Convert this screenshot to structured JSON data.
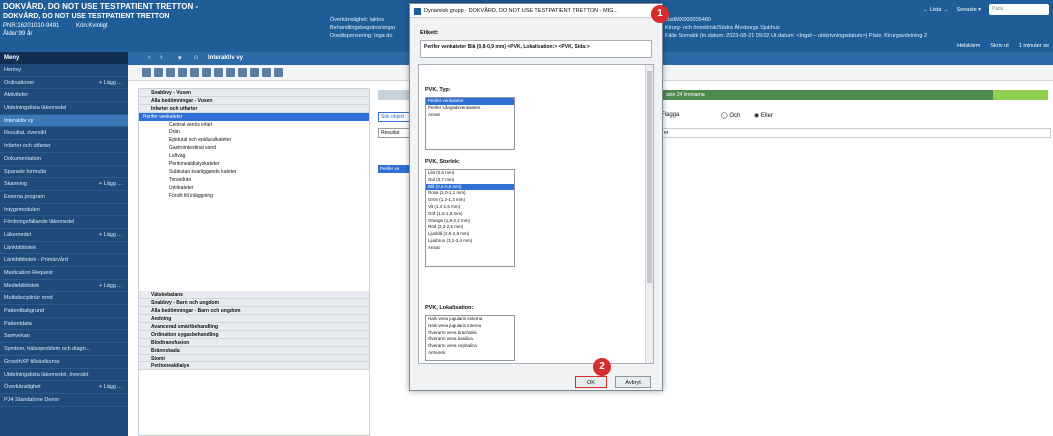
{
  "header": {
    "title": "DOKVÅRD, DO NOT USE TESTPATIENT TRETTON -",
    "subtitle": "DOKVÅRD, DO NOT USE TESTPATIENT TRETTON",
    "pnr": "PNR:16201010-9491",
    "kon": "Kön:Kvinligt",
    "age": "Ålder:99 år",
    "mid_lines": [
      "Överkänslighet: laktos",
      "Behandlingsbegränsningar",
      "Dosdispensering: Inga do"
    ],
    "right_lines": [
      "elsdMX000035480",
      "Kirurg- och öronklinik/Södra Älvsborgs Sjukhus",
      "Fälle Somatik (In.datum: 2023-08-21 09:02 Ut.datum: <Inget – utskrivningsdatum>) Plats: Kirurgavdelning 2"
    ],
    "lista": "← Lista →",
    "senaste": "Senaste ▾",
    "search_placeholder": "Patie",
    "helskarm": "Helskärm",
    "skriv_ut": "Skriv ut",
    "minuter": "1 minuter se"
  },
  "sidebar": {
    "menu_title": "Meny",
    "add_label": "+ Lägg ...",
    "items": [
      {
        "label": "Hemvy",
        "add": false,
        "active": false
      },
      {
        "label": "Ordinationer",
        "add": true,
        "active": false
      },
      {
        "label": "Aktiviteter",
        "add": false,
        "active": false
      },
      {
        "label": "Utdelningslista läkemedel",
        "add": false,
        "active": false
      },
      {
        "label": "Interaktiv vy",
        "add": false,
        "active": true
      },
      {
        "label": "Resultat, översikt",
        "add": false,
        "active": false
      },
      {
        "label": "Infarter och utfarter",
        "add": false,
        "active": false
      },
      {
        "label": "Dokumentation",
        "add": false,
        "active": false
      },
      {
        "label": "Sparade formulär",
        "add": false,
        "active": false
      },
      {
        "label": "Skanning",
        "add": true,
        "active": false
      },
      {
        "label": "Externa program",
        "add": false,
        "active": false
      },
      {
        "label": "Intygsmodulen",
        "add": false,
        "active": false
      },
      {
        "label": "Fördningsfällande läkemedel",
        "add": false,
        "active": false
      },
      {
        "label": "Läkemedel",
        "add": true,
        "active": false
      },
      {
        "label": "Länkbibliotek",
        "add": false,
        "active": false
      },
      {
        "label": "Länkbibliotek - Primärvård",
        "add": false,
        "active": false
      },
      {
        "label": "Medication Request",
        "add": false,
        "active": false
      },
      {
        "label": "Mediebibliotek",
        "add": true,
        "active": false
      },
      {
        "label": "Multidisciplinär rond",
        "add": false,
        "active": false
      },
      {
        "label": "Patientbakgrund",
        "add": false,
        "active": false
      },
      {
        "label": "Patientdata",
        "add": false,
        "active": false
      },
      {
        "label": "Samvekan",
        "add": false,
        "active": false
      },
      {
        "label": "Symtom, hälsoproblem och diagn...",
        "add": false,
        "active": false
      },
      {
        "label": "GrowthXP tillväxtkurva",
        "add": false,
        "active": false
      },
      {
        "label": "Utdelningslista läkemedel, översikt",
        "add": false,
        "active": false
      },
      {
        "label": "Överkänslighet",
        "add": true,
        "active": false
      },
      {
        "label": "PJ4 Standalone Demo",
        "add": false,
        "active": false
      }
    ]
  },
  "main": {
    "tab_label": "Interaktiv vy",
    "tree_top": [
      {
        "label": "Snabbvy - Vuxen",
        "type": "group"
      },
      {
        "label": "Alla bedömningar - Vuxen",
        "type": "group"
      },
      {
        "label": "Infarter och utfarter",
        "type": "group"
      },
      {
        "label": "Perifer venkateter",
        "type": "sel"
      },
      {
        "label": "Central venös infart",
        "type": "sub"
      },
      {
        "label": "Drän",
        "type": "sub"
      },
      {
        "label": "Epidural och epiduralkateter",
        "type": "sub"
      },
      {
        "label": "Gastrointestinal sond",
        "type": "sub"
      },
      {
        "label": "Luftväg",
        "type": "sub"
      },
      {
        "label": "Peritonealdialyskateter",
        "type": "sub"
      },
      {
        "label": "Subkutan kvarliggande kateter",
        "type": "sub"
      },
      {
        "label": "Toraxdrän",
        "type": "sub"
      },
      {
        "label": "Urinkateter",
        "type": "sub"
      },
      {
        "label": "Förslit till inläggning",
        "type": "sub"
      }
    ],
    "tree_bottom": [
      "Vätskebalans",
      "Snabbvy - Barn och ungdom",
      "Alla bedömningar - Barn och ungdom",
      "Andning",
      "Avancerad smärtbehandling",
      "Ordination sygasbehandling",
      "Blodtransfusion",
      "Brännskada",
      "Stomi",
      "Peritonealdialys"
    ],
    "right": {
      "bar_text": "aste 24 timmarna",
      "search_text": "Sök objekt",
      "select_value": "Resultat",
      "flagga": "Flagga",
      "radio_och": "◯ Och",
      "radio_eller": "◉ Eller",
      "input_text": "er",
      "cell_text": "Perifer ve"
    }
  },
  "dialog": {
    "title": "Dynamisk grupp - DOKVÅRD, DO NOT USE TESTPATIENT TRETTON - MIG...",
    "close": "✕",
    "etikett_label": "Etikett:",
    "etikett_value": "Perifer venkateter Blå (0,8-0,9 mm) <PVK, Lokalisation:> <PVK, Sida:>",
    "typ_label": "PVK, Typ:",
    "typ_options": [
      "Perifer venkateter",
      "Perifer Långtidsvenkateter",
      "Annat"
    ],
    "typ_selected": 0,
    "storlek_label": "PVK, Storlek:",
    "storlek_options": [
      "Lila (0,6 mm)",
      "Gul (0,7 mm)",
      "Blå (0,8-0,9 mm)",
      "Rosa (1,0-1,1 mm)",
      "Grön (1,2-1,3 mm)",
      "Vit (1,4-1,5 mm)",
      "Grå (1,6-1,8 mm)",
      "Orange (1,9-2,2 mm)",
      "Röd (2,3-2,5 mm)",
      "Ljusblå (2,6-2,8 mm)",
      "Ljusbrun (3,1-3,4 mm)",
      "Annat"
    ],
    "storlek_selected": 2,
    "lokal_label": "PVK, Lokalisation:",
    "lokal_options": [
      "Hals vena jugularis externa",
      "Hals vena jugularis interna",
      "Överarm vena brachialis",
      "Överarm vena basilica",
      "Överarm vena cephalica",
      "Armveck"
    ],
    "ok_label": "OK",
    "cancel_label": "Avbryt"
  },
  "callouts": {
    "one": "1",
    "two": "2"
  }
}
